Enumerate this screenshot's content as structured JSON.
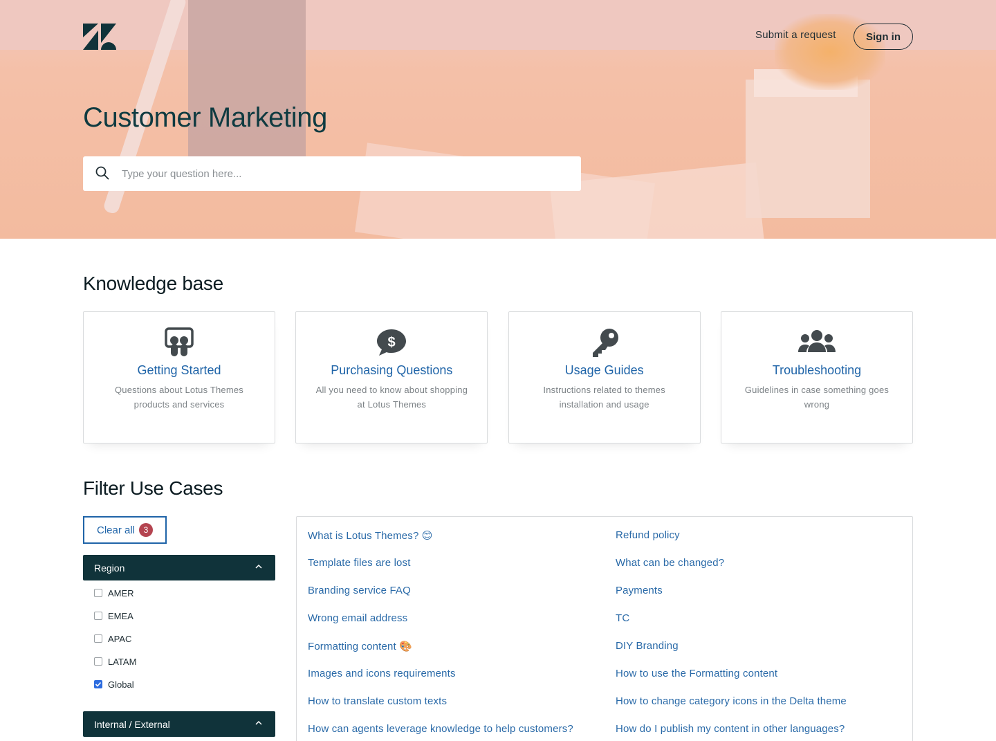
{
  "header": {
    "submit_request": "Submit a request",
    "sign_in": "Sign in",
    "logo_icon": "zendesk-logo"
  },
  "hero": {
    "title": "Customer Marketing",
    "search_placeholder": "Type your question here..."
  },
  "knowledge_base": {
    "title": "Knowledge base",
    "cards": [
      {
        "title": "Getting Started",
        "desc": "Questions about Lotus Themes products and services",
        "icon": "slideshare-icon"
      },
      {
        "title": "Purchasing Questions",
        "desc": "All you need to know about shopping at Lotus Themes",
        "icon": "dollar-chat-icon"
      },
      {
        "title": "Usage Guides",
        "desc": "Instructions related to themes installation and usage",
        "icon": "key-icon"
      },
      {
        "title": "Troubleshooting",
        "desc": "Guidelines in case something goes wrong",
        "icon": "users-icon"
      }
    ]
  },
  "filter": {
    "title": "Filter Use Cases",
    "clear_all": "Clear all",
    "clear_count": "3",
    "region": {
      "label": "Region",
      "options": [
        {
          "label": "AMER",
          "checked": false
        },
        {
          "label": "EMEA",
          "checked": false
        },
        {
          "label": "APAC",
          "checked": false
        },
        {
          "label": "LATAM",
          "checked": false
        },
        {
          "label": "Global",
          "checked": true
        }
      ]
    },
    "internal_external": {
      "label": "Internal / External"
    }
  },
  "results": {
    "left": [
      "What is Lotus Themes? 😊",
      "Template files are lost",
      "Branding service FAQ",
      "Wrong email address",
      "Formatting content 🎨",
      "Images and icons requirements",
      "How to translate custom texts",
      "How can agents leverage knowledge to help customers?"
    ],
    "right": [
      "Refund policy",
      "What can be changed?",
      "Payments",
      "TC",
      "DIY Branding",
      "How to use the Formatting content",
      "How to change category icons in the Delta theme",
      "How do I publish my content in other languages?"
    ]
  },
  "colors": {
    "accent": "#1f64a8",
    "dark_header": "#10333a",
    "badge": "#b44450",
    "hero_bg": "#f3bb9f"
  }
}
